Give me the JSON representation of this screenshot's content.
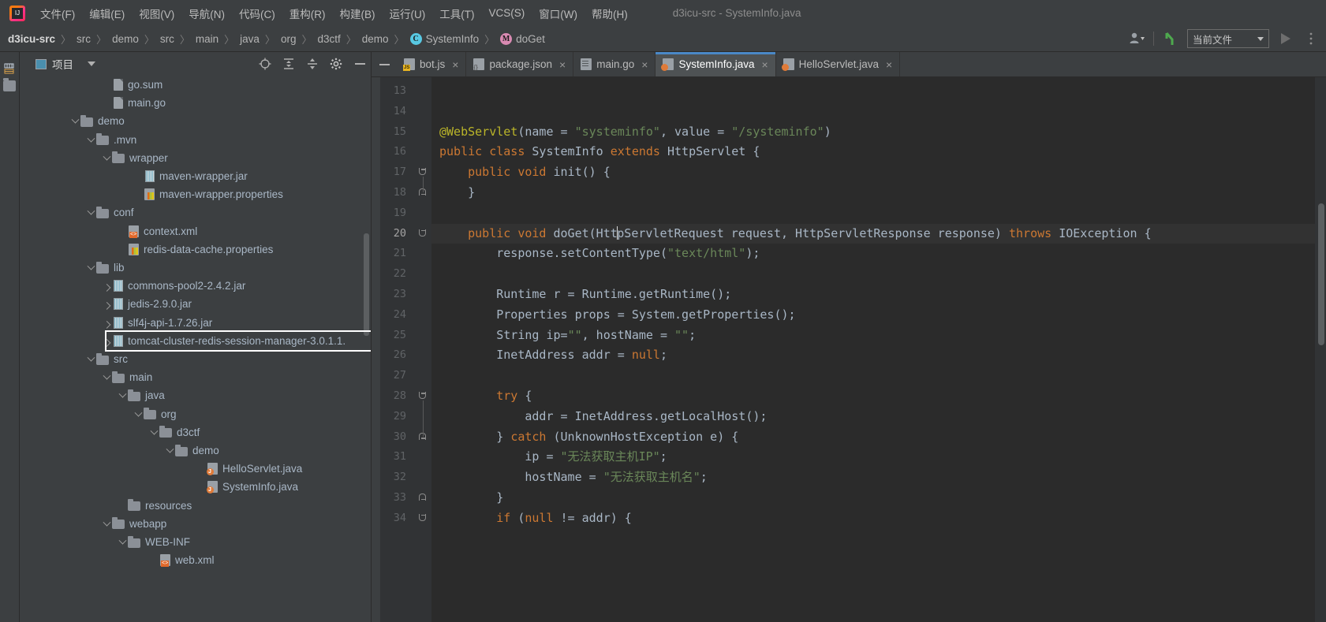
{
  "window": {
    "title": "d3icu-src - SystemInfo.java",
    "logo_icon": "intellij-idea-logo"
  },
  "menubar": {
    "items": [
      {
        "label": "文件(F)",
        "name": "menu-file"
      },
      {
        "label": "编辑(E)",
        "name": "menu-edit"
      },
      {
        "label": "视图(V)",
        "name": "menu-view"
      },
      {
        "label": "导航(N)",
        "name": "menu-navigate"
      },
      {
        "label": "代码(C)",
        "name": "menu-code"
      },
      {
        "label": "重构(R)",
        "name": "menu-refactor"
      },
      {
        "label": "构建(B)",
        "name": "menu-build"
      },
      {
        "label": "运行(U)",
        "name": "menu-run"
      },
      {
        "label": "工具(T)",
        "name": "menu-tools"
      },
      {
        "label": "VCS(S)",
        "name": "menu-vcs"
      },
      {
        "label": "窗口(W)",
        "name": "menu-window"
      },
      {
        "label": "帮助(H)",
        "name": "menu-help"
      }
    ]
  },
  "breadcrumb": {
    "items": [
      {
        "label": "d3icu-src",
        "bold": true,
        "icon": ""
      },
      {
        "label": "src",
        "bold": false,
        "icon": ""
      },
      {
        "label": "demo",
        "bold": false,
        "icon": ""
      },
      {
        "label": "src",
        "bold": false,
        "icon": ""
      },
      {
        "label": "main",
        "bold": false,
        "icon": ""
      },
      {
        "label": "java",
        "bold": false,
        "icon": ""
      },
      {
        "label": "org",
        "bold": false,
        "icon": ""
      },
      {
        "label": "d3ctf",
        "bold": false,
        "icon": ""
      },
      {
        "label": "demo",
        "bold": false,
        "icon": ""
      },
      {
        "label": "SystemInfo",
        "bold": false,
        "icon": "c"
      },
      {
        "label": "doGet",
        "bold": false,
        "icon": "m"
      }
    ],
    "separator": "〉"
  },
  "toolbar_right": {
    "run_config_label": "当前文件",
    "person_icon": "person-icon",
    "hook_icon": "git-branch-icon",
    "run_icon": "run-play-icon",
    "more_icon": "more-vertical-icon"
  },
  "project_panel": {
    "title": "项目",
    "tools": [
      {
        "name": "locate-target-icon"
      },
      {
        "name": "expand-all-icon"
      },
      {
        "name": "collapse-all-icon"
      },
      {
        "name": "settings-gear-icon"
      },
      {
        "name": "hide-panel-icon"
      }
    ],
    "tree": [
      {
        "label": "go.sum",
        "indent": 4,
        "twisty": "",
        "icon": "file",
        "name": "tree-item-go-sum"
      },
      {
        "label": "main.go",
        "indent": 4,
        "twisty": "",
        "icon": "file",
        "name": "tree-item-main-go"
      },
      {
        "label": "demo",
        "indent": 2,
        "twisty": "down",
        "icon": "folder",
        "name": "tree-item-demo"
      },
      {
        "label": ".mvn",
        "indent": 3,
        "twisty": "down",
        "icon": "folder",
        "name": "tree-item-mvn"
      },
      {
        "label": "wrapper",
        "indent": 4,
        "twisty": "down",
        "icon": "folder",
        "name": "tree-item-wrapper"
      },
      {
        "label": "maven-wrapper.jar",
        "indent": 6,
        "twisty": "",
        "icon": "jar",
        "name": "tree-item-maven-wrapper-jar"
      },
      {
        "label": "maven-wrapper.properties",
        "indent": 6,
        "twisty": "",
        "icon": "props",
        "name": "tree-item-maven-wrapper-properties"
      },
      {
        "label": "conf",
        "indent": 3,
        "twisty": "down",
        "icon": "folder",
        "name": "tree-item-conf"
      },
      {
        "label": "context.xml",
        "indent": 5,
        "twisty": "",
        "icon": "xml",
        "name": "tree-item-context-xml"
      },
      {
        "label": "redis-data-cache.properties",
        "indent": 5,
        "twisty": "",
        "icon": "props",
        "name": "tree-item-redis-data-cache-properties"
      },
      {
        "label": "lib",
        "indent": 3,
        "twisty": "down",
        "icon": "folder",
        "name": "tree-item-lib"
      },
      {
        "label": "commons-pool2-2.4.2.jar",
        "indent": 4,
        "twisty": "right",
        "icon": "jar",
        "name": "tree-item-commons-pool2-jar"
      },
      {
        "label": "jedis-2.9.0.jar",
        "indent": 4,
        "twisty": "right",
        "icon": "jar",
        "name": "tree-item-jedis-jar"
      },
      {
        "label": "slf4j-api-1.7.26.jar",
        "indent": 4,
        "twisty": "right",
        "icon": "jar",
        "name": "tree-item-slf4j-api-jar"
      },
      {
        "label": "tomcat-cluster-redis-session-manager-3.0.1.1.",
        "indent": 4,
        "twisty": "right",
        "icon": "jar",
        "name": "tree-item-tomcat-cluster-redis-session-manager-jar",
        "highlighted": true
      },
      {
        "label": "src",
        "indent": 3,
        "twisty": "down",
        "icon": "folder",
        "name": "tree-item-src"
      },
      {
        "label": "main",
        "indent": 4,
        "twisty": "down",
        "icon": "folder",
        "name": "tree-item-main"
      },
      {
        "label": "java",
        "indent": 5,
        "twisty": "down",
        "icon": "folder",
        "name": "tree-item-java"
      },
      {
        "label": "org",
        "indent": 6,
        "twisty": "down",
        "icon": "folder",
        "name": "tree-item-org"
      },
      {
        "label": "d3ctf",
        "indent": 7,
        "twisty": "down",
        "icon": "folder",
        "name": "tree-item-d3ctf"
      },
      {
        "label": "demo",
        "indent": 8,
        "twisty": "down",
        "icon": "folder",
        "name": "tree-item-demo-pkg"
      },
      {
        "label": "HelloServlet.java",
        "indent": 10,
        "twisty": "",
        "icon": "java",
        "name": "tree-item-helloservlet-java"
      },
      {
        "label": "SystemInfo.java",
        "indent": 10,
        "twisty": "",
        "icon": "java",
        "name": "tree-item-systeminfo-java"
      },
      {
        "label": "resources",
        "indent": 5,
        "twisty": "",
        "icon": "folder",
        "name": "tree-item-resources"
      },
      {
        "label": "webapp",
        "indent": 4,
        "twisty": "down",
        "icon": "folder",
        "name": "tree-item-webapp"
      },
      {
        "label": "WEB-INF",
        "indent": 5,
        "twisty": "down",
        "icon": "folder",
        "name": "tree-item-web-inf"
      },
      {
        "label": "web.xml",
        "indent": 7,
        "twisty": "",
        "icon": "xml",
        "name": "tree-item-web-xml"
      }
    ]
  },
  "editor": {
    "tabs": [
      {
        "label": "bot.js",
        "icon": "js",
        "active": false,
        "name": "tab-bot-js"
      },
      {
        "label": "package.json",
        "icon": "json",
        "active": false,
        "name": "tab-package-json"
      },
      {
        "label": "main.go",
        "icon": "go",
        "active": false,
        "name": "tab-main-go"
      },
      {
        "label": "SystemInfo.java",
        "icon": "java",
        "active": true,
        "name": "tab-systeminfo-java"
      },
      {
        "label": "HelloServlet.java",
        "icon": "java",
        "active": false,
        "name": "tab-helloservlet-java"
      }
    ],
    "close_glyph": "×",
    "first_line_number": 13,
    "current_line": 20,
    "lines": [
      {
        "n": 13,
        "fold": "",
        "html": ""
      },
      {
        "n": 14,
        "fold": "",
        "html": ""
      },
      {
        "n": 15,
        "fold": "",
        "html": "<span class=\"ann\">@WebServlet</span>(name = <span class=\"str\">\"systeminfo\"</span>, value = <span class=\"str\">\"/systeminfo\"</span>)"
      },
      {
        "n": 16,
        "fold": "",
        "html": "<span class=\"kw\">public class</span> SystemInfo <span class=\"kw\">extends</span> HttpServlet {"
      },
      {
        "n": 17,
        "fold": "open",
        "html": "    <span class=\"kw\">public void</span> init() {"
      },
      {
        "n": 18,
        "fold": "close",
        "html": "    }"
      },
      {
        "n": 19,
        "fold": "",
        "html": ""
      },
      {
        "n": 20,
        "fold": "open",
        "html": "    <span class=\"kw\">public void</span> doGet(HttpServletRequest request, HttpServletResponse response) <span class=\"kw\">throws</span> IOException {",
        "current": true
      },
      {
        "n": 21,
        "fold": "",
        "html": "        response.setContentType(<span class=\"str\">\"text/html\"</span>);"
      },
      {
        "n": 22,
        "fold": "",
        "html": ""
      },
      {
        "n": 23,
        "fold": "",
        "html": "        Runtime r = Runtime.getRuntime();"
      },
      {
        "n": 24,
        "fold": "",
        "html": "        Properties props = System.getProperties();"
      },
      {
        "n": 25,
        "fold": "",
        "html": "        String ip=<span class=\"str\">\"\"</span>, hostName = <span class=\"str\">\"\"</span>;"
      },
      {
        "n": 26,
        "fold": "",
        "html": "        InetAddress addr = <span class=\"kw\">null</span>;"
      },
      {
        "n": 27,
        "fold": "",
        "html": ""
      },
      {
        "n": 28,
        "fold": "open",
        "html": "        <span class=\"kw\">try</span> {"
      },
      {
        "n": 29,
        "fold": "",
        "html": "            addr = InetAddress.getLocalHost();"
      },
      {
        "n": 30,
        "fold": "close",
        "html": "        } <span class=\"kw\">catch</span> (UnknownHostException e) {"
      },
      {
        "n": 31,
        "fold": "",
        "html": "            ip = <span class=\"str\">\"无法获取主机IP\"</span>;"
      },
      {
        "n": 32,
        "fold": "",
        "html": "            hostName = <span class=\"str\">\"无法获取主机名\"</span>;"
      },
      {
        "n": 33,
        "fold": "close",
        "html": "        }"
      },
      {
        "n": 34,
        "fold": "open",
        "html": "        <span class=\"kw\">if</span> (<span class=\"kw\">null</span> != addr) {"
      }
    ]
  },
  "left_strip": {
    "project_label": "项目",
    "icons": [
      "project-structure-icon",
      "folder-icon"
    ]
  }
}
